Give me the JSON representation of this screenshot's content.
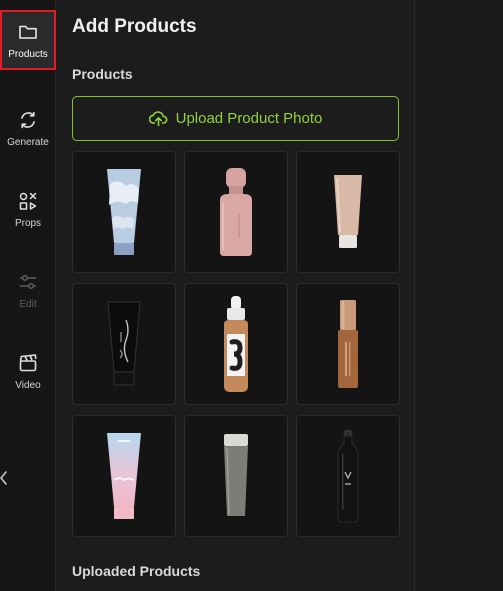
{
  "rail": {
    "items": [
      {
        "label": "Products",
        "icon": "folder-icon"
      },
      {
        "label": "Generate",
        "icon": "refresh-icon"
      },
      {
        "label": "Props",
        "icon": "shapes-icon"
      },
      {
        "label": "Edit",
        "icon": "sliders-icon"
      },
      {
        "label": "Video",
        "icon": "clapperboard-icon"
      }
    ],
    "active": "Products",
    "disabled": [
      "Edit"
    ]
  },
  "panel": {
    "title": "Add Products",
    "products_section": "Products",
    "upload_button": "Upload Product Photo",
    "uploaded_section": "Uploaded Products"
  },
  "products": [
    {
      "icon": "blue-cloud-tube-icon"
    },
    {
      "icon": "pink-bottle-icon"
    },
    {
      "icon": "beige-tube-icon"
    },
    {
      "icon": "black-tube-icon"
    },
    {
      "icon": "dropper-bottle-icon"
    },
    {
      "icon": "foundation-bottle-icon"
    },
    {
      "icon": "pastel-tube-icon"
    },
    {
      "icon": "gray-tube-icon"
    },
    {
      "icon": "black-water-bottle-icon"
    }
  ],
  "colors": {
    "accent_green": "#8fd43c",
    "active_outline": "#e51b23",
    "background": "#1c1c1c"
  }
}
